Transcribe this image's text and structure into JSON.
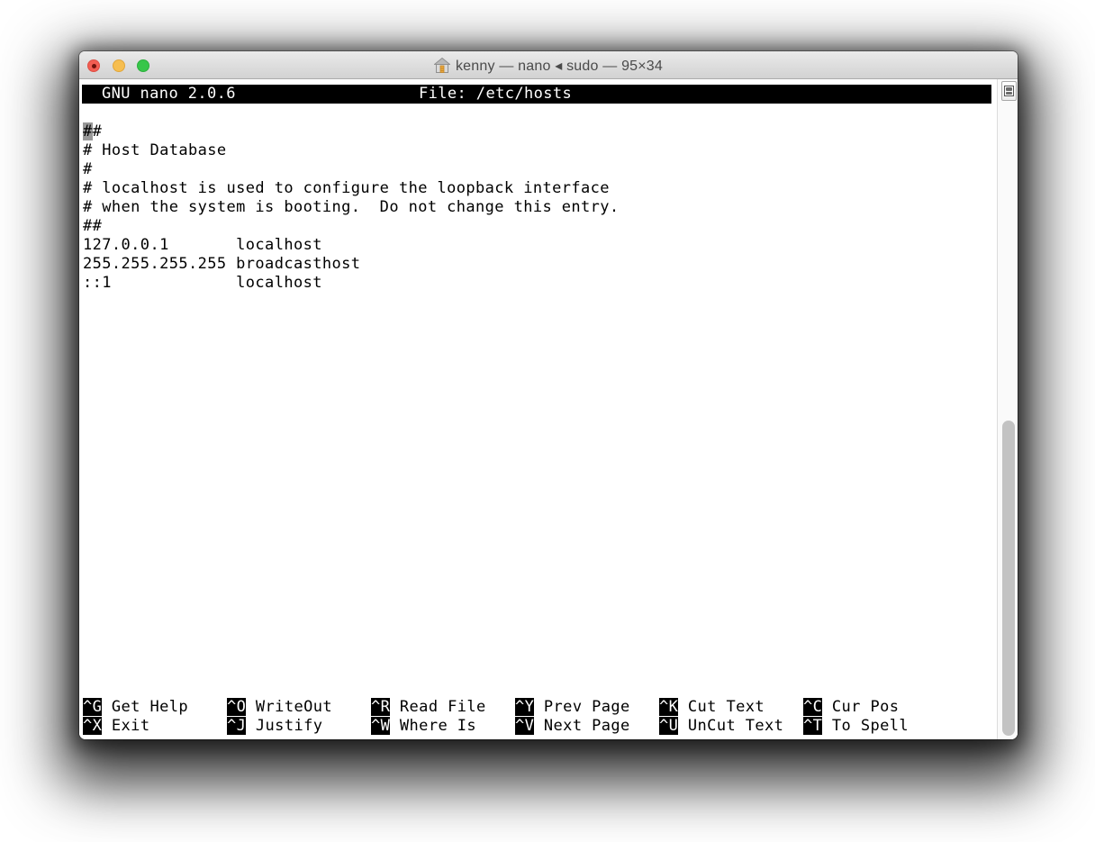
{
  "window": {
    "title": "kenny — nano ◂ sudo — 95×34",
    "proxy_icon": "home-folder-icon",
    "traffic_lights": {
      "close_color": "#f25e52",
      "close_modified_dot_color": "#6d130c",
      "minimize_color": "#f6be50",
      "zoom_color": "#37c64a",
      "document_modified": true
    }
  },
  "terminal": {
    "columns": 95,
    "rows": 34,
    "background_color": "#ffffff",
    "text_color": "#000000",
    "cursor_color": "#989898"
  },
  "nano": {
    "version_label": "GNU nano 2.0.6",
    "file_label": "File: /etc/hosts",
    "header_bg": "#000000",
    "header_fg": "#ffffff",
    "content_lines": [
      {
        "text": "##",
        "cursor_at": 0
      },
      {
        "text": "# Host Database"
      },
      {
        "text": "#"
      },
      {
        "text": "# localhost is used to configure the loopback interface"
      },
      {
        "text": "# when the system is booting.  Do not change this entry."
      },
      {
        "text": "##"
      },
      {
        "text": "127.0.0.1       localhost"
      },
      {
        "text": "255.255.255.255 broadcasthost"
      },
      {
        "text": "::1             localhost"
      }
    ],
    "shortcuts_row1": [
      {
        "key": "^G",
        "label": "Get Help"
      },
      {
        "key": "^O",
        "label": "WriteOut"
      },
      {
        "key": "^R",
        "label": "Read File"
      },
      {
        "key": "^Y",
        "label": "Prev Page"
      },
      {
        "key": "^K",
        "label": "Cut Text"
      },
      {
        "key": "^C",
        "label": "Cur Pos"
      }
    ],
    "shortcuts_row2": [
      {
        "key": "^X",
        "label": "Exit"
      },
      {
        "key": "^J",
        "label": "Justify"
      },
      {
        "key": "^W",
        "label": "Where Is"
      },
      {
        "key": "^V",
        "label": "Next Page"
      },
      {
        "key": "^U",
        "label": "UnCut Text"
      },
      {
        "key": "^T",
        "label": "To Spell"
      }
    ]
  },
  "scrollbar": {
    "thumb_color": "#c3c3c3",
    "split_button_icon": "split-pane-icon"
  }
}
